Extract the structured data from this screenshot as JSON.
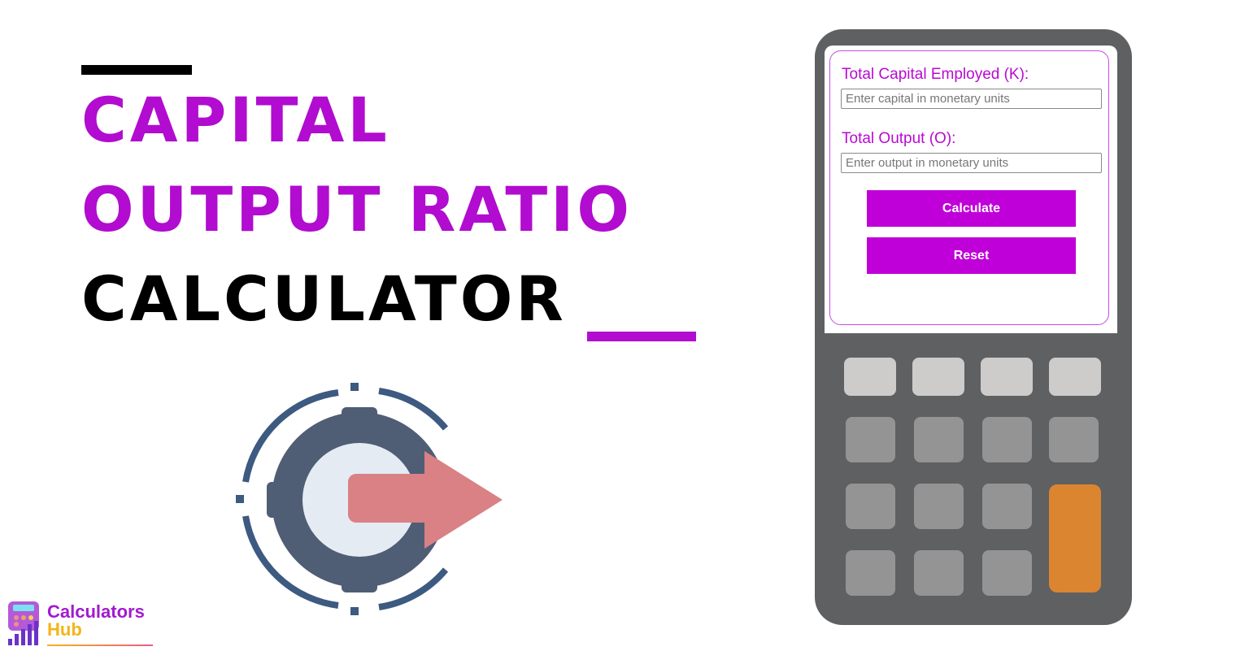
{
  "title": {
    "line1": "Capital",
    "line2": "Output Ratio",
    "line3": "Calculator"
  },
  "colors": {
    "accent": "#b10cd0",
    "button": "#c000d8",
    "device_body": "#5f6062",
    "key_light": "#cdcccb",
    "key_dark": "#949494",
    "key_orange": "#db8530",
    "gear": "#4f5d75",
    "ring": "#3d5a80",
    "arrow": "#d98185"
  },
  "form": {
    "capital_label": "Total Capital Employed (K):",
    "capital_placeholder": "Enter capital in monetary units",
    "capital_value": "",
    "output_label": "Total Output (O):",
    "output_placeholder": "Enter output in monetary units",
    "output_value": "",
    "calculate_label": "Calculate",
    "reset_label": "Reset"
  },
  "logo": {
    "line1": "Calculators",
    "line2": "Hub"
  },
  "icons": {
    "illustration": "gear-with-arrow-icon",
    "logo": "calculator-chart-icon"
  }
}
